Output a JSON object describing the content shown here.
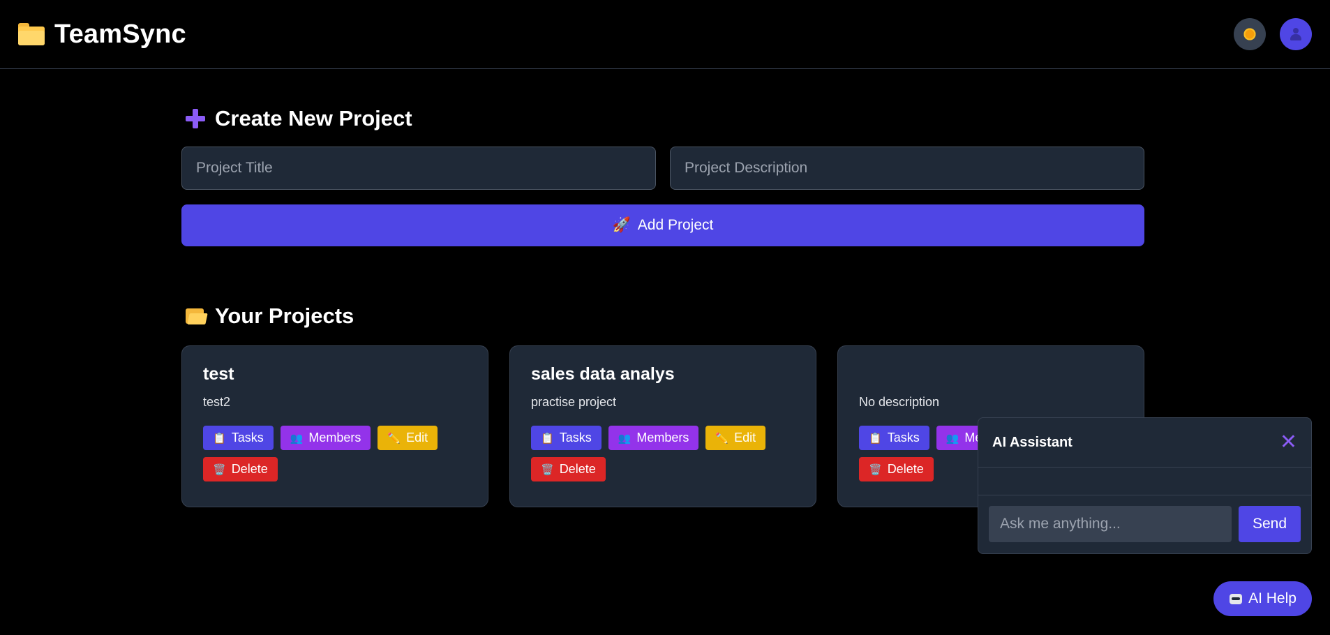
{
  "app": {
    "name": "TeamSync",
    "theme_icon": "sun-icon",
    "user_icon": "user-icon"
  },
  "create": {
    "title": "Create New Project",
    "title_placeholder": "Project Title",
    "description_placeholder": "Project Description",
    "add_label": "Add Project",
    "add_icon": "🚀"
  },
  "projects": {
    "title": "Your Projects",
    "items": [
      {
        "title": "test",
        "description": "test2"
      },
      {
        "title": "sales data analys",
        "description": "practise project"
      },
      {
        "title": "",
        "description": "No description"
      }
    ],
    "actions": {
      "tasks": "Tasks",
      "members": "Members",
      "edit": "Edit",
      "delete": "Delete",
      "tasks_icon": "📋",
      "members_icon": "👥",
      "edit_icon": "✏️",
      "delete_icon": "🗑️"
    }
  },
  "assistant": {
    "title": "AI Assistant",
    "close": "✕",
    "placeholder": "Ask me anything...",
    "send": "Send"
  },
  "help_button": {
    "label": "AI Help"
  },
  "colors": {
    "accent": "#4f46e5",
    "members": "#9333ea",
    "edit": "#eab308",
    "delete": "#dc2626",
    "card": "#1f2937"
  }
}
